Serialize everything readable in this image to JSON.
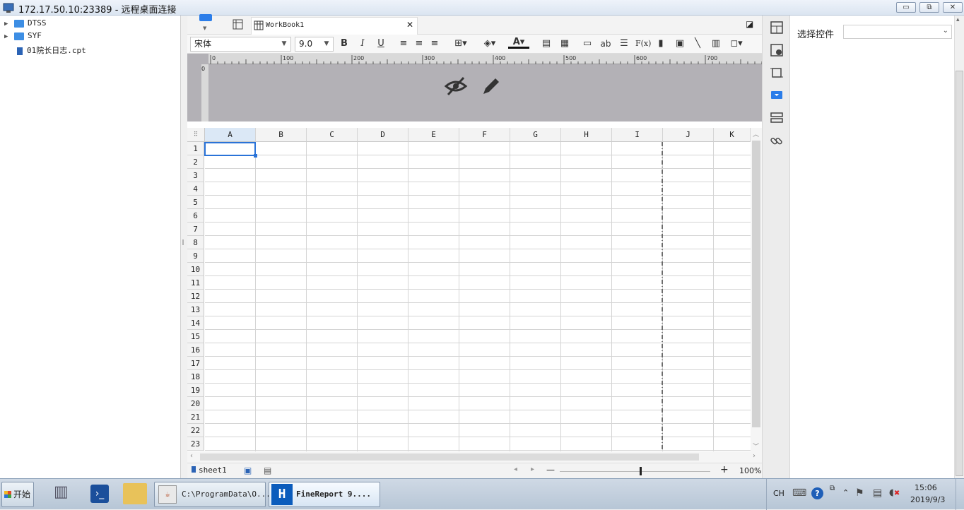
{
  "window": {
    "title": "172.17.50.10:23389 - 远程桌面连接",
    "minimize": "▭",
    "restore": "⧉",
    "close": "✕"
  },
  "tree": {
    "items": [
      {
        "label": "DTSS",
        "type": "folder"
      },
      {
        "label": "SYF",
        "type": "folder"
      },
      {
        "label": "01院长日志.cpt",
        "type": "file"
      }
    ]
  },
  "editor": {
    "tab_label": "WorkBook1",
    "tab_close": "✕",
    "font_name": "宋体",
    "font_size": "9.0",
    "bold": "B",
    "italic": "I",
    "underline": "U",
    "text_color_label": "A",
    "abc_label": "ab",
    "formula_label": "F(x)",
    "ruler_ticks": [
      "0",
      "100",
      "200",
      "300",
      "400",
      "500",
      "600",
      "700"
    ],
    "ruler_v0": "0"
  },
  "grid": {
    "columns": [
      "A",
      "B",
      "C",
      "D",
      "E",
      "F",
      "G",
      "H",
      "I",
      "J",
      "K"
    ],
    "rows": [
      "1",
      "2",
      "3",
      "4",
      "5",
      "6",
      "7",
      "8",
      "9",
      "10",
      "11",
      "12",
      "13",
      "14",
      "15",
      "16",
      "17",
      "18",
      "19",
      "20",
      "21",
      "22",
      "23"
    ],
    "selected_cell": "A1"
  },
  "footer": {
    "sheet_name": "sheet1",
    "zoom": "100%",
    "zoom_minus": "—",
    "zoom_plus": "+",
    "zoom_fraction": 0.53
  },
  "props": {
    "label": "选择控件",
    "select_value": ""
  },
  "taskbar": {
    "start": "开始",
    "task1": "C:\\ProgramData\\O...",
    "task2": "FineReport 9....",
    "lang": "CH",
    "time": "15:06",
    "date": "2019/9/3"
  },
  "colors": {
    "accent": "#2b7de9",
    "select_border": "#2a73d8",
    "ruler_bg": "#b3b1b6",
    "page_break": "#000000"
  }
}
